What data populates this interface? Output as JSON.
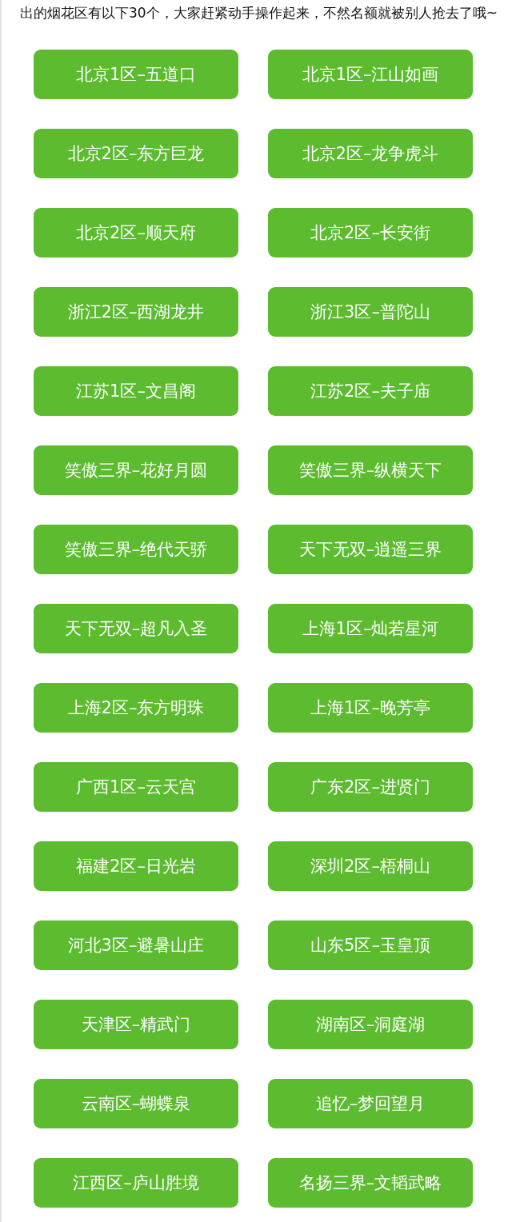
{
  "intro": "出的烟花区有以下30个，大家赶紧动手操作起来，不然名额就被别人抢去了哦~",
  "servers": [
    "北京1区–五道口",
    "北京1区–江山如画",
    "北京2区–东方巨龙",
    "北京2区–龙争虎斗",
    "北京2区–顺天府",
    "北京2区–长安街",
    "浙江2区–西湖龙井",
    "浙江3区–普陀山",
    "江苏1区–文昌阁",
    "江苏2区–夫子庙",
    "笑傲三界–花好月圆",
    "笑傲三界–纵横天下",
    "笑傲三界–绝代天骄",
    "天下无双–逍遥三界",
    "天下无双–超凡入圣",
    "上海1区–灿若星河",
    "上海2区–东方明珠",
    "上海1区–晚芳亭",
    "广西1区–云天宫",
    "广东2区–进贤门",
    "福建2区–日光岩",
    "深圳2区–梧桐山",
    "河北3区–避暑山庄",
    "山东5区–玉皇顶",
    "天津区–精武门",
    "湖南区–洞庭湖",
    "云南区–蝴蝶泉",
    "追忆–梦回望月",
    "江西区–庐山胜境",
    "名扬三界–文韬武略"
  ]
}
